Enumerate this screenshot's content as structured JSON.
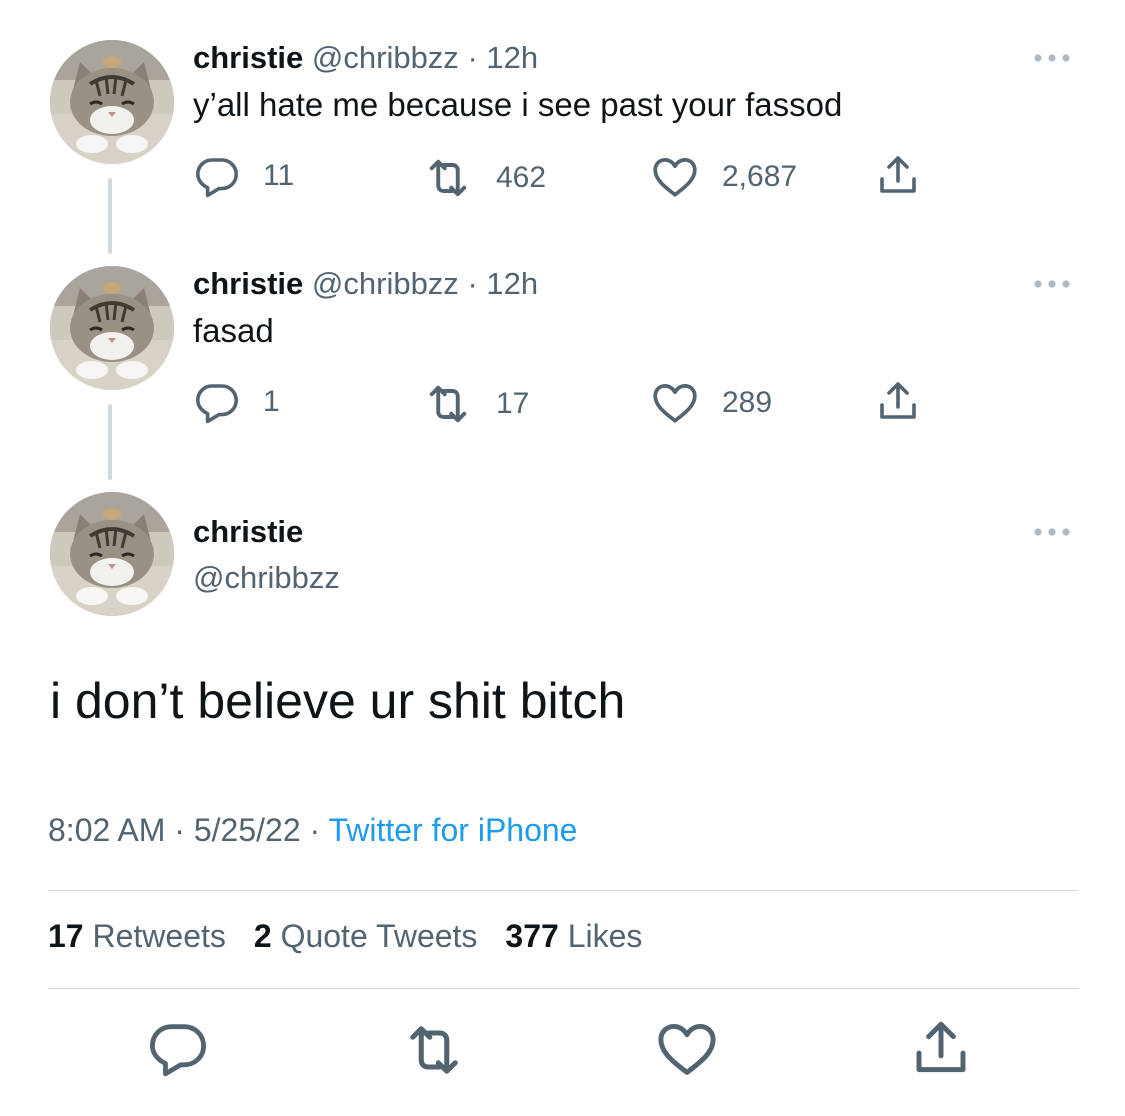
{
  "tweets": [
    {
      "name": "christie",
      "handle": "@chribbzz",
      "separator": "·",
      "time": "12h",
      "text": "y’all hate me because i see past your fassod",
      "replies": "11",
      "retweets": "462",
      "likes": "2,687"
    },
    {
      "name": "christie",
      "handle": "@chribbzz",
      "separator": "·",
      "time": "12h",
      "text": "fasad",
      "replies": "1",
      "retweets": "17",
      "likes": "289"
    }
  ],
  "main_tweet": {
    "name": "christie",
    "handle": "@chribbzz",
    "text": "i don’t believe ur shit bitch",
    "time": "8:02 AM",
    "date": "5/25/22",
    "separator": "·",
    "source": "Twitter for iPhone",
    "stats": {
      "retweets_count": "17",
      "retweets_label": "Retweets",
      "quotes_count": "2",
      "quotes_label": "Quote Tweets",
      "likes_count": "377",
      "likes_label": "Likes"
    }
  },
  "icons": {
    "reply": "reply-icon",
    "retweet": "retweet-icon",
    "like": "heart-icon",
    "share": "share-icon",
    "more": "more-icon"
  },
  "colors": {
    "text": "#0f1419",
    "secondary": "#536471",
    "link": "#1d9bf0",
    "divider": "#cfd9de"
  }
}
